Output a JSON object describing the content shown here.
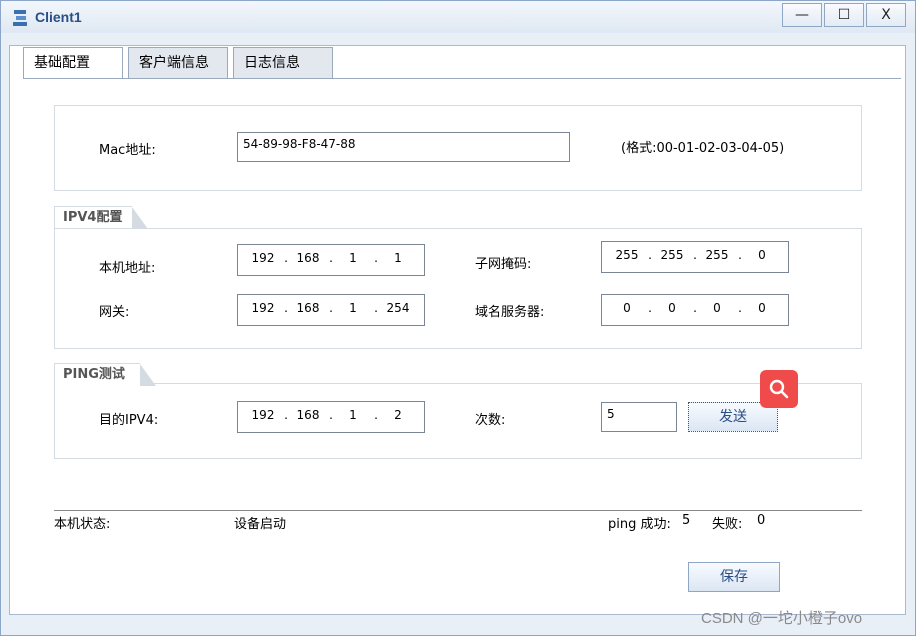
{
  "window": {
    "title": "Client1",
    "controls": {
      "minimize": "—",
      "maximize": "☐",
      "close": "X"
    }
  },
  "tabs": [
    {
      "label": "基础配置",
      "active": true
    },
    {
      "label": "客户端信息",
      "active": false
    },
    {
      "label": "日志信息",
      "active": false
    }
  ],
  "mac": {
    "label": "Mac地址:",
    "value": "54-89-98-F8-47-88",
    "hint": "(格式:00-01-02-03-04-05)"
  },
  "ipv4": {
    "section_title": "IPV4配置",
    "local_addr": {
      "label": "本机地址:",
      "octets": [
        "192",
        "168",
        "1",
        "1"
      ]
    },
    "subnet": {
      "label": "子网掩码:",
      "octets": [
        "255",
        "255",
        "255",
        "0"
      ]
    },
    "gateway": {
      "label": "网关:",
      "octets": [
        "192",
        "168",
        "1",
        "254"
      ]
    },
    "dns": {
      "label": "域名服务器:",
      "octets": [
        "0",
        "0",
        "0",
        "0"
      ]
    }
  },
  "ping": {
    "section_title": "PING测试",
    "dest": {
      "label": "目的IPV4:",
      "octets": [
        "192",
        "168",
        "1",
        "2"
      ]
    },
    "count": {
      "label": "次数:",
      "value": "5"
    },
    "send_label": "发送"
  },
  "status": {
    "label": "本机状态:",
    "value": "设备启动",
    "ping_success_label": "ping 成功:",
    "ping_success_value": "5",
    "fail_label": "失败:",
    "fail_value": "0"
  },
  "save_label": "保存",
  "watermark": "CSDN @一坨小橙子ovo",
  "colors": {
    "accent": "#2a4e86",
    "fab": "#ef4b4b"
  },
  "icons": {
    "app": "network-client-icon",
    "fab": "search-icon"
  }
}
